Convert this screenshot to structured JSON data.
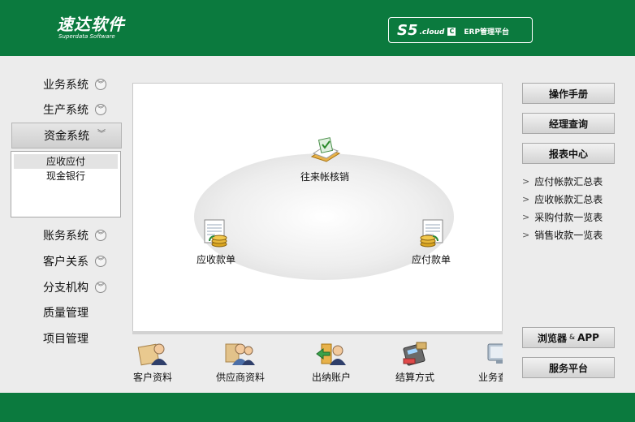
{
  "header": {
    "logo_cn": "速达软件",
    "logo_en": "Superdata Software",
    "badge_s5": "S5",
    "badge_cloud": ".cloud",
    "badge_c": "C",
    "badge_erp": "ERP管理平台"
  },
  "sidebar": {
    "items": [
      {
        "label": "业务系统"
      },
      {
        "label": "生产系统"
      },
      {
        "label": "资金系统"
      },
      {
        "label": "账务系统"
      },
      {
        "label": "客户关系"
      },
      {
        "label": "分支机构"
      },
      {
        "label": "质量管理"
      },
      {
        "label": "项目管理"
      }
    ],
    "submenu": [
      "应收应付",
      "现金银行"
    ]
  },
  "diagram": {
    "nodes": [
      "往来帐核销",
      "应收款单",
      "应付款单"
    ]
  },
  "shortcuts": [
    "客户资料",
    "供应商资料",
    "出纳账户",
    "结算方式",
    "业务查"
  ],
  "right": {
    "buttons": [
      "操作手册",
      "经理查询",
      "报表中心"
    ],
    "links": [
      "应付帐款汇总表",
      "应收帐款汇总表",
      "采购付款一览表",
      "销售收款一览表"
    ],
    "browser_left": "浏览器",
    "browser_amp": "&",
    "browser_right": "APP",
    "service": "服务平台"
  }
}
